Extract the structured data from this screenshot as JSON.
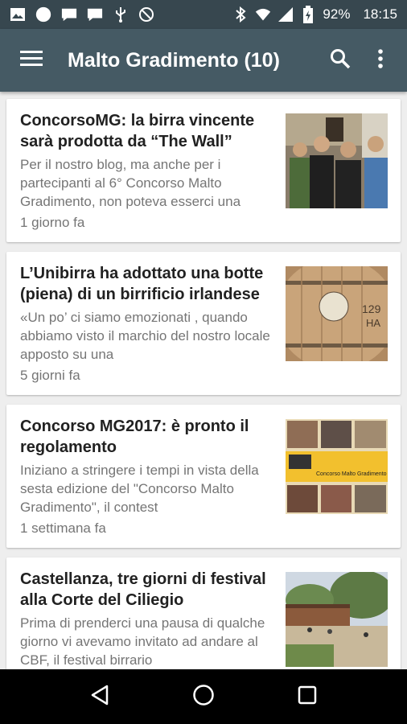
{
  "status_bar": {
    "battery": "92%",
    "time": "18:15",
    "icons": [
      "image-icon",
      "circle-notification-icon",
      "message-icon",
      "message-icon",
      "usb-icon",
      "block-icon",
      "bluetooth-icon",
      "wifi-icon",
      "signal-icon",
      "battery-icon"
    ]
  },
  "app_bar": {
    "title": "Malto Gradimento (10)",
    "icons": [
      "menu-icon",
      "search-icon",
      "more-vert-icon"
    ]
  },
  "articles": [
    {
      "title": "ConcorsoMG: la birra vincente sarà prodotta da “The Wall”",
      "excerpt": "Per il nostro blog, ma anche per i partecipanti al 6° Concorso Malto Gradimento, non poteva esserci una",
      "time": "1 giorno fa"
    },
    {
      "title": "L’Unibirra ha adottato una botte (piena) di un birrificio irlandese",
      "excerpt": "«Un po’ ci siamo emozionati , quando abbiamo visto il marchio del nostro locale apposto su una",
      "time": "5 giorni fa"
    },
    {
      "title": "Concorso MG2017: è pronto il regolamento",
      "excerpt": "Iniziano a stringere i tempi in vista della sesta edizione del \"Concorso Malto Gradimento\", il contest",
      "time": "1 settimana fa"
    },
    {
      "title": "Castellanza, tre giorni di festival alla Corte del Ciliegio",
      "excerpt": "Prima di prenderci una pausa di qualche giorno vi avevamo invitato ad andare al CBF, il festival birrario",
      "time": ""
    }
  ],
  "nav_bar": {
    "icons": [
      "back-icon",
      "home-icon",
      "recents-icon"
    ]
  },
  "colors": {
    "status_bar": "#37474f",
    "app_bar": "#455a64",
    "background": "#eeeeee",
    "card": "#ffffff",
    "title_text": "#212121",
    "secondary_text": "#757575"
  }
}
